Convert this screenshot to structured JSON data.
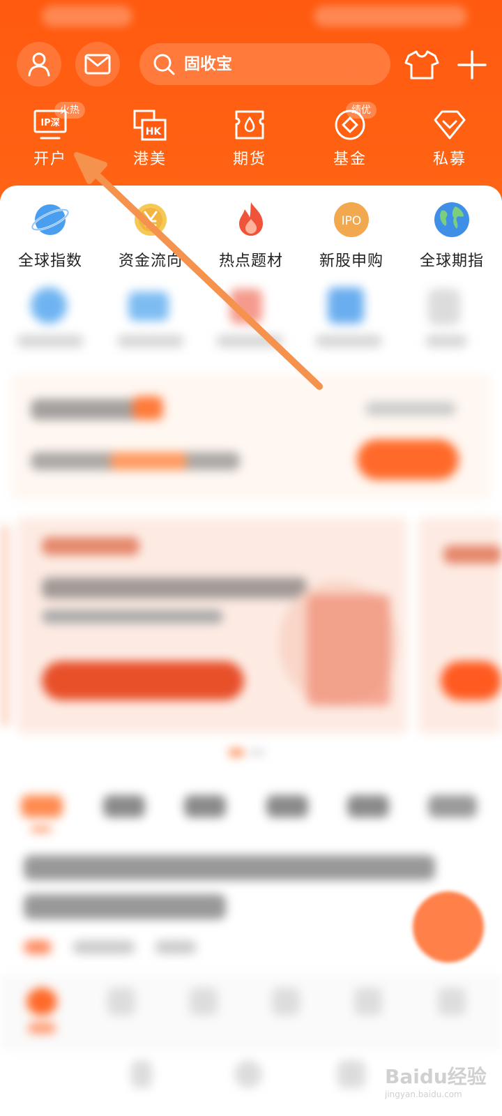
{
  "header": {
    "search_placeholder": "固收宝",
    "quick_nav": [
      {
        "label": "开户",
        "badge": "火热",
        "icon": "ipo-account-icon"
      },
      {
        "label": "港美",
        "badge": "",
        "icon": "hk-us-icon"
      },
      {
        "label": "期货",
        "badge": "",
        "icon": "futures-icon"
      },
      {
        "label": "基金",
        "badge": "绩优",
        "icon": "fund-icon"
      },
      {
        "label": "私募",
        "badge": "",
        "icon": "private-fund-icon"
      }
    ]
  },
  "functions": [
    {
      "label": "全球指数",
      "icon": "planet-icon",
      "color": "#4a9ef0"
    },
    {
      "label": "资金流向",
      "icon": "yuan-coin-icon",
      "color": "#f2b640"
    },
    {
      "label": "热点题材",
      "icon": "flame-icon",
      "color": "#f0533a"
    },
    {
      "label": "新股申购",
      "icon": "ipo-icon",
      "icon_text": "IPO",
      "color": "#f2a84e"
    },
    {
      "label": "全球期指",
      "icon": "globe-icon",
      "color": "#3f8fe6"
    }
  ],
  "watermark": {
    "text": "Baidu经验",
    "sub": "jingyan.baidu.com"
  },
  "colors": {
    "brand": "#ff5a10",
    "accent": "#ff6a2a"
  }
}
